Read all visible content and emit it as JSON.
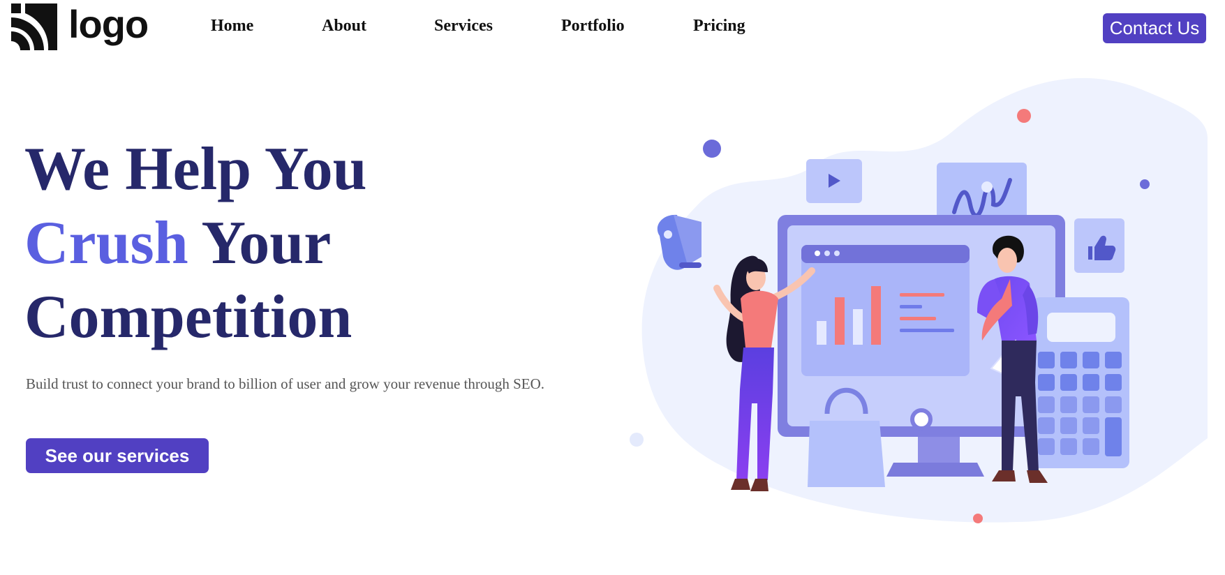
{
  "navbar": {
    "logo_text": "logo",
    "links": [
      "Home",
      "About",
      "Services",
      "Portfolio",
      "Pricing"
    ],
    "contact_label": "Contact Us"
  },
  "hero": {
    "title_line1": "We Help You",
    "title_accent": "Crush",
    "title_line2_rest": " Your",
    "title_line3": "Competition",
    "subtitle": "Build trust to connect your brand to billion of user and grow your revenue through SEO.",
    "cta_label": "See our services"
  },
  "colors": {
    "brand_purple": "#5140c2",
    "title_navy": "#26286a",
    "accent_blue": "#5a5fe0"
  },
  "icons": [
    "logo-icon",
    "play-icon",
    "thumbs-up-icon",
    "megaphone-icon"
  ]
}
